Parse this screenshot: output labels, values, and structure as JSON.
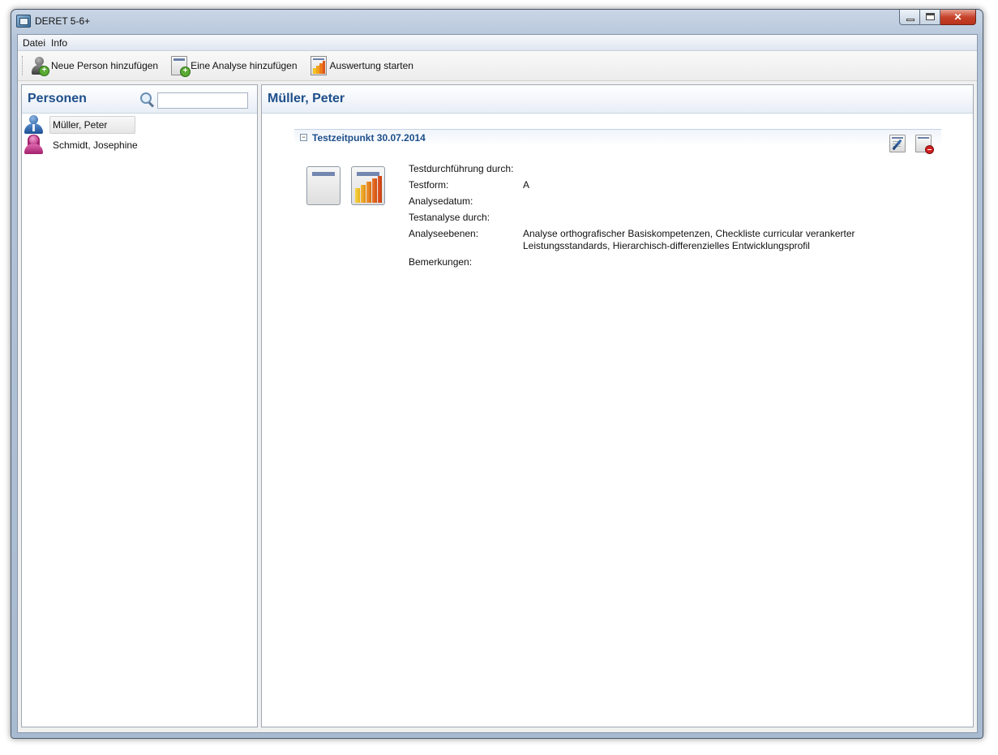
{
  "window": {
    "title": "DERET 5-6+"
  },
  "menu": {
    "items": [
      "Datei",
      "Info"
    ]
  },
  "toolbar": {
    "add_person": "Neue Person hinzufügen",
    "add_analysis": "Eine Analyse hinzufügen",
    "start_evaluation": "Auswertung starten"
  },
  "persons_panel": {
    "title": "Personen",
    "search_value": "",
    "items": [
      {
        "name": "Müller, Peter",
        "icon": "male-person-icon",
        "selected": true
      },
      {
        "name": "Schmidt, Josephine",
        "icon": "female-person-icon",
        "selected": false
      }
    ]
  },
  "detail": {
    "title": "Müller, Peter",
    "section": {
      "collapse_glyph": "−",
      "title": "Testzeitpunkt 30.07.2014",
      "fields": [
        {
          "label": "Testdurchführung durch:",
          "value": ""
        },
        {
          "label": "Testform:",
          "value": "A"
        },
        {
          "label": "Analysedatum:",
          "value": ""
        },
        {
          "label": "Testanalyse durch:",
          "value": ""
        },
        {
          "label": "Analyseebenen:",
          "value": "Analyse orthografischer Basiskompetenzen, Checkliste curricular verankerter Leistungsstandards, Hierarchisch-differenzielles Entwicklungsprofil"
        },
        {
          "label": "Bemerkungen:",
          "value": ""
        }
      ]
    }
  },
  "colors": {
    "accent_title": "#1e4f8a",
    "female_icon": "#c93a92",
    "male_icon": "#2c63a8"
  }
}
